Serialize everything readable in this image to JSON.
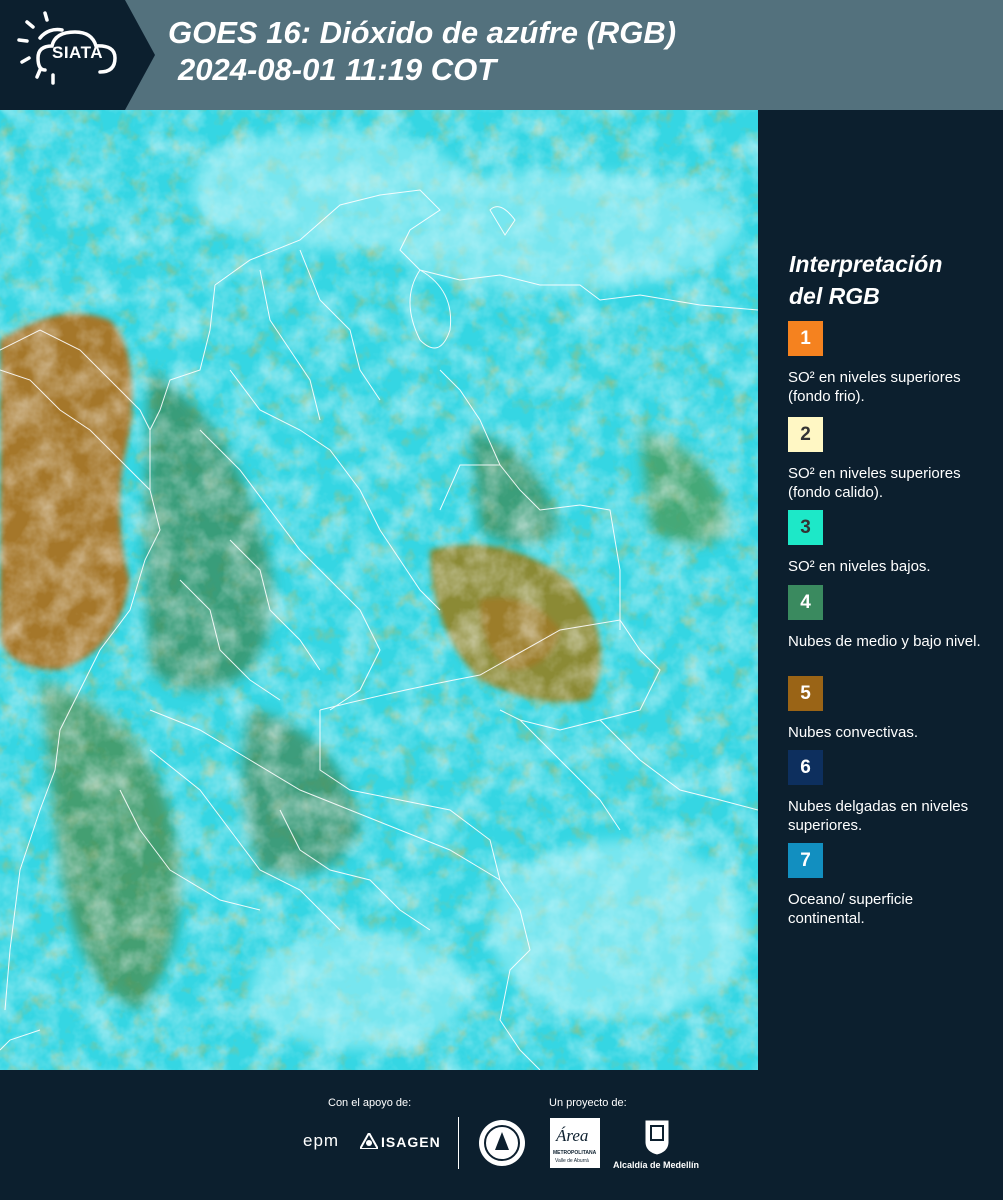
{
  "header": {
    "logo_text": "SIATA",
    "title_line1": "GOES 16: Dióxido de azúfre (RGB)",
    "title_line2": "2024-08-01 11:19 COT"
  },
  "legend": {
    "title_line1": "Interpretación",
    "title_line2": "del RGB",
    "items": [
      {
        "number": "1",
        "label": "SO² en niveles superiores (fondo frio).",
        "color": "#f5821f",
        "text_color": "#ffffff"
      },
      {
        "number": "2",
        "label": "SO² en niveles superiores (fondo calido).",
        "color": "#fff7c4",
        "text_color": "#333333"
      },
      {
        "number": "3",
        "label": "SO² en niveles bajos.",
        "color": "#1de8c8",
        "text_color": "#333333"
      },
      {
        "number": "4",
        "label": "Nubes de medio y bajo nivel.",
        "color": "#3a8a5f",
        "text_color": "#ffffff"
      },
      {
        "number": "5",
        "label": "Nubes convectivas.",
        "color": "#9a6416",
        "text_color": "#ffffff"
      },
      {
        "number": "6",
        "label": "Nubes delgadas en niveles superiores.",
        "color": "#0d2f5e",
        "text_color": "#ffffff"
      },
      {
        "number": "7",
        "label": "Oceano/ superficie continental.",
        "color": "#128fc0",
        "text_color": "#ffffff"
      }
    ]
  },
  "footer": {
    "support_label": "Con el apoyo de:",
    "project_label": "Un proyecto de:",
    "sponsor_epm": "epm",
    "sponsor_isagen": "ISAGEN",
    "area_metro_name": "Área",
    "area_metro_sub": "METROPOLITANA",
    "area_metro_sub2": "Valle de Aburrá",
    "alcaldia": "Alcaldía de Medellín"
  },
  "colors": {
    "header_bg": "#53717d",
    "panel_bg": "#0c1f2e",
    "map_cyan": "#3fdde8"
  }
}
